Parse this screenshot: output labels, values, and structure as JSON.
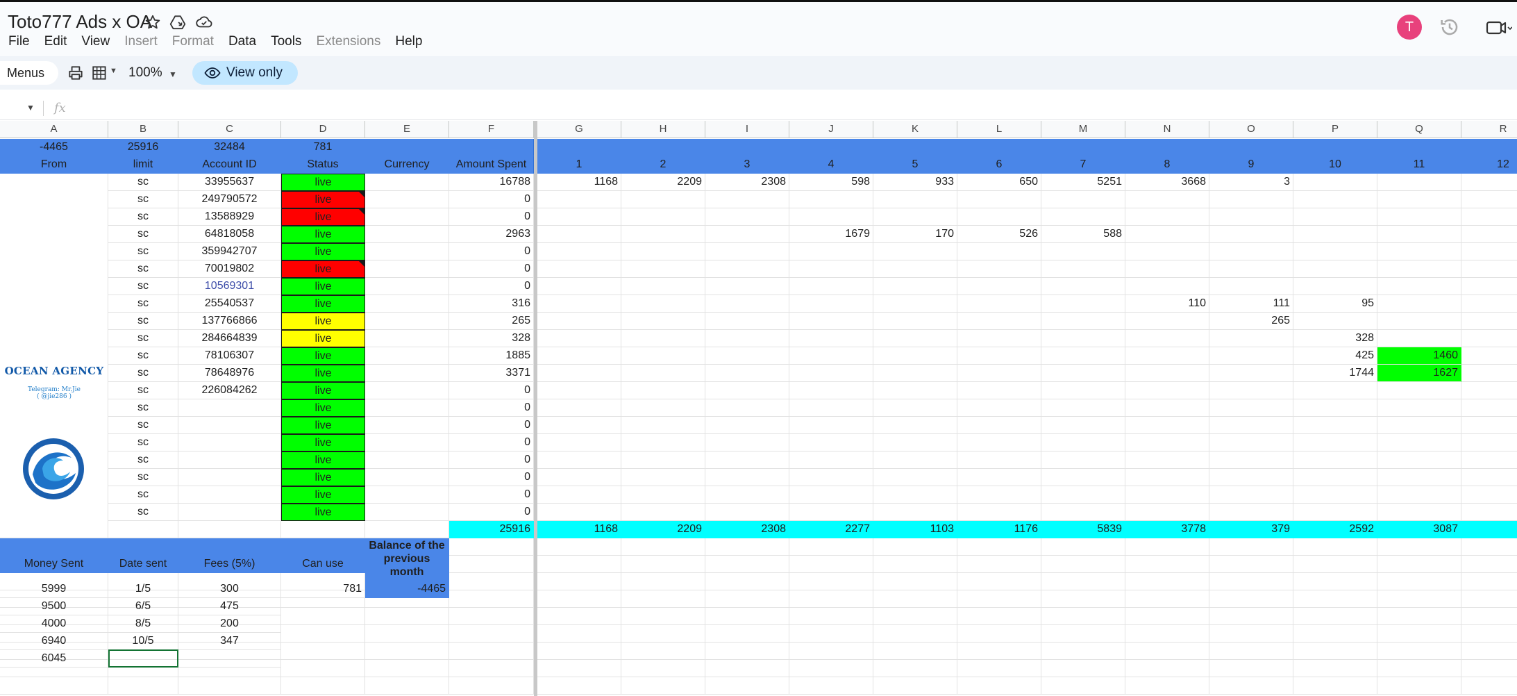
{
  "app": {
    "doc_title": "Toto777 Ads x OA",
    "menu": [
      {
        "label": "File",
        "disabled": false
      },
      {
        "label": "Edit",
        "disabled": false
      },
      {
        "label": "View",
        "disabled": false
      },
      {
        "label": "Insert",
        "disabled": true
      },
      {
        "label": "Format",
        "disabled": true
      },
      {
        "label": "Data",
        "disabled": false
      },
      {
        "label": "Tools",
        "disabled": false
      },
      {
        "label": "Extensions",
        "disabled": true
      },
      {
        "label": "Help",
        "disabled": false
      }
    ],
    "avatar_letter": "T",
    "avatar_color": "#e8417c"
  },
  "toolbar": {
    "menus_label": "Menus",
    "zoom": "100%",
    "view_only_label": "View only"
  },
  "formula_bar": {
    "fx_label": "fx"
  },
  "sheet": {
    "columns": [
      "A",
      "B",
      "C",
      "D",
      "E",
      "F",
      "G",
      "H",
      "I",
      "J",
      "K",
      "L",
      "M",
      "N",
      "O",
      "P",
      "Q",
      "R"
    ],
    "totals_row": {
      "A": "-4465",
      "B": "25916",
      "C": "32484",
      "D": "781"
    },
    "header_row": {
      "A": "From",
      "B": "limit",
      "C": "Account ID",
      "D": "Status",
      "E": "Currency",
      "F": "Amount Spent",
      "days": [
        "1",
        "2",
        "3",
        "4",
        "5",
        "6",
        "7",
        "8",
        "9",
        "10",
        "11",
        "12"
      ]
    },
    "accounts": [
      {
        "limit": "sc",
        "id": "33955637",
        "status": "live",
        "status_color": "green",
        "spent": "16788",
        "days": {
          "G": "1168",
          "H": "2209",
          "I": "2308",
          "J": "598",
          "K": "933",
          "L": "650",
          "M": "5251",
          "N": "3668",
          "O": "3"
        }
      },
      {
        "limit": "sc",
        "id": "249790572",
        "status": "live",
        "status_color": "red",
        "spent": "0",
        "days": {}
      },
      {
        "limit": "sc",
        "id": "13588929",
        "status": "live",
        "status_color": "red",
        "spent": "0",
        "days": {}
      },
      {
        "limit": "sc",
        "id": "64818058",
        "status": "live",
        "status_color": "green",
        "spent": "2963",
        "days": {
          "J": "1679",
          "K": "170",
          "L": "526",
          "M": "588"
        }
      },
      {
        "limit": "sc",
        "id": "359942707",
        "status": "live",
        "status_color": "green",
        "spent": "0",
        "days": {}
      },
      {
        "limit": "sc",
        "id": "70019802",
        "status": "live",
        "status_color": "red",
        "spent": "0",
        "days": {}
      },
      {
        "limit": "sc",
        "id": "10569301",
        "status": "live",
        "status_color": "green",
        "spent": "0",
        "days": {}
      },
      {
        "limit": "sc",
        "id": "25540537",
        "status": "live",
        "status_color": "green",
        "spent": "316",
        "days": {
          "N": "110",
          "O": "111",
          "P": "95"
        }
      },
      {
        "limit": "sc",
        "id": "137766866",
        "status": "live",
        "status_color": "yellow",
        "spent": "265",
        "days": {
          "O": "265"
        }
      },
      {
        "limit": "sc",
        "id": "284664839",
        "status": "live",
        "status_color": "yellow",
        "spent": "328",
        "days": {
          "P": "328"
        }
      },
      {
        "limit": "sc",
        "id": "78106307",
        "status": "live",
        "status_color": "green",
        "spent": "1885",
        "days": {
          "P": "425",
          "Q": "1460"
        }
      },
      {
        "limit": "sc",
        "id": "78648976",
        "status": "live",
        "status_color": "green",
        "spent": "3371",
        "days": {
          "P": "1744",
          "Q": "1627"
        }
      },
      {
        "limit": "sc",
        "id": "226084262",
        "status": "live",
        "status_color": "green",
        "spent": "0",
        "days": {}
      },
      {
        "limit": "sc",
        "id": "",
        "status": "live",
        "status_color": "green",
        "spent": "0",
        "days": {}
      },
      {
        "limit": "sc",
        "id": "",
        "status": "live",
        "status_color": "green",
        "spent": "0",
        "days": {}
      },
      {
        "limit": "sc",
        "id": "",
        "status": "live",
        "status_color": "green",
        "spent": "0",
        "days": {}
      },
      {
        "limit": "sc",
        "id": "",
        "status": "live",
        "status_color": "green",
        "spent": "0",
        "days": {}
      },
      {
        "limit": "sc",
        "id": "",
        "status": "live",
        "status_color": "green",
        "spent": "0",
        "days": {}
      },
      {
        "limit": "sc",
        "id": "",
        "status": "live",
        "status_color": "green",
        "spent": "0",
        "days": {}
      },
      {
        "limit": "sc",
        "id": "",
        "status": "live",
        "status_color": "green",
        "spent": "0",
        "days": {}
      }
    ],
    "spend_totals": {
      "F": "25916",
      "G": "1168",
      "H": "2209",
      "I": "2308",
      "J": "2277",
      "K": "1103",
      "L": "1176",
      "M": "5839",
      "N": "3778",
      "O": "379",
      "P": "2592",
      "Q": "3087"
    },
    "payments_header": {
      "A": "Money Sent",
      "B": "Date sent",
      "C": "Fees (5%)",
      "D": "Can use",
      "E": "Balance of the previous month"
    },
    "payments": [
      {
        "money": "5999",
        "date": "1/5",
        "fee": "300",
        "can_use": "781",
        "balance": "-4465"
      },
      {
        "money": "9500",
        "date": "6/5",
        "fee": "475",
        "can_use": "",
        "balance": ""
      },
      {
        "money": "4000",
        "date": "8/5",
        "fee": "200",
        "can_use": "",
        "balance": ""
      },
      {
        "money": "6940",
        "date": "10/5",
        "fee": "347",
        "can_use": "",
        "balance": ""
      },
      {
        "money": "6045",
        "date": "",
        "fee": "",
        "can_use": "",
        "balance": ""
      }
    ],
    "logo": {
      "name": "OCEAN AGENCY",
      "tagline_1": "Telegram: Mr.Jie",
      "tagline_2": "( @jie286 )"
    },
    "colors": {
      "header_blue": "#4a86e8",
      "status_live": "#00ff00",
      "status_red": "#ff0000",
      "status_yellow": "#ffff00",
      "totals_cyan": "#00ffff"
    }
  }
}
